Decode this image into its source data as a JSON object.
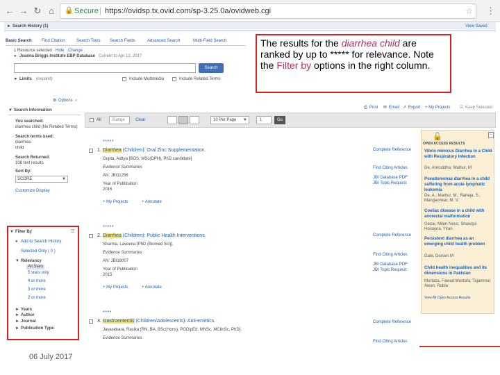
{
  "browser": {
    "secure_label": "Secure",
    "url": "https://ovidsp.tx.ovid.com/sp-3.25.0a/ovidweb.cgi"
  },
  "header": {
    "search_history": "Search History (1)",
    "view_saved": "View Saved"
  },
  "search": {
    "tabs": [
      "Basic Search",
      "Find Citation",
      "Search Tools",
      "Search Fields",
      "Advanced Search",
      "Multi-Field Search"
    ],
    "resources_selected": "1 Resource selected",
    "hide": "Hide",
    "change": "Change",
    "database": "Joanna Briggs Institute EBP Database",
    "database_date": "Current to Apr 12, 2017",
    "search_button": "Search",
    "limits_label": "Limits",
    "limits_value": "(expand)",
    "include_multimedia": "Include Multimedia",
    "include_related": "Include Related Terms"
  },
  "callout": {
    "text_a": "The results for the ",
    "text_b": "diarrhea child",
    "text_c": " are ranked by up to ***** for relevance.  Note the ",
    "text_d": "Filter by",
    "text_e": " options in the right column."
  },
  "left": {
    "options": "Options",
    "search_information": "Search Information",
    "you_searched": "You searched:",
    "searched_value": "diarrhea child (No Related Terms)",
    "terms_used": "Search terms used:",
    "term1": "diarrhea",
    "term2": "child",
    "search_returned": "Search Returned:",
    "returned_value": "108 text results",
    "sort_by": "Sort By:",
    "sort_value": "SCORE",
    "customize": "Customize Display",
    "filter_by": "Filter By",
    "add_history": "Add to Search History",
    "selected_only": "Selected Only ( 0 )",
    "relevancy": "Relevancy",
    "stars": [
      "All Stars",
      "5 stars only",
      "4 or more",
      "3 or more",
      "2 or more"
    ],
    "years": "Years",
    "author": "Author",
    "journal": "Journal",
    "pubtype": "Publication Type"
  },
  "toolbar": {
    "all": "All",
    "range": "Range",
    "clear": "Clear",
    "per_page": "10 Per Page",
    "page": "1",
    "go": "Go",
    "print": "Print",
    "email": "Email",
    "export": "Export",
    "my_projects": "+ My Projects",
    "keep_selected": "Keep Selected"
  },
  "results": [
    {
      "num": "1.",
      "stars": "*****",
      "title_mark": "Diarrhea",
      "title_rest": " (Children): Oral Zinc Supplementation.",
      "author": "Gupta, Aditya [BOS, MSc(DPH), PhD candidate]",
      "type": "Evidence Summaries",
      "an": "AN: JBI11256",
      "year_label": "Year of Publication",
      "year": "2016",
      "complete_ref": "Complete Reference",
      "find_citing": "Find Citing Articles",
      "pdf": "JBI Database PDF",
      "topic": "JBI Topic Request",
      "my_projects": "+ My Projects",
      "annotate": "+ Annotate"
    },
    {
      "num": "2.",
      "stars": "*****",
      "title_mark": "Diarrhea",
      "title_rest": " (Children): Public Health Interventions.",
      "author": "Sharma, Laveena [PhD (Biomed Sci)].",
      "type": "Evidence Summaries",
      "an": "AN: JBI18007",
      "year_label": "Year of Publication",
      "year": "2015",
      "complete_ref": "Complete Reference",
      "find_citing": "Find Citing Articles",
      "pdf": "JBI Database PDF",
      "topic": "JBI Topic Request",
      "my_projects": "+ My Projects",
      "annotate": "+ Annotate"
    },
    {
      "num": "3.",
      "stars": "****",
      "title_mark": "Gastroenteritis",
      "title_rest": " (Children/Adolescents): Anti-emetics.",
      "author": "Jayasekara, Rasika [RN, BA, BSc(Hons), PGDipEd, MNSc, MClinSc, PhD].",
      "type": "Evidence Summaries",
      "complete_ref": "Complete Reference",
      "find_citing": "Find Citing Articles"
    }
  ],
  "side": {
    "header": "OPEN ACCESS RESULTS",
    "items": [
      {
        "title": "Vibrio mimicus Diarrhea in a Child with Respiratory Infection",
        "author": "De, Aniruddha; Mathur, M"
      },
      {
        "title": "Pseudomonas diarrhea in a child suffering from acute lymphatic leukemia",
        "author": "De, A.; Mathur, M.; Raheja, S.; Mangaonkar, M. V."
      },
      {
        "title": "Coeliac disease in a child with anorectal malformation",
        "author": "Gezai, Milen Neus; Shawqui Hosayna, Yiran"
      },
      {
        "title": "Persistent diarrhea as an emerging child health problem",
        "author": "Gale, Dorsen M"
      },
      {
        "title": "Child health inequalities and its dimensions in Pakistan",
        "author": "Murtaza, Fawad Mustafa; Tajammal Awan, Robia"
      }
    ],
    "view_all": "View All Open Access Results"
  },
  "footer": {
    "date": "06 July 2017"
  }
}
